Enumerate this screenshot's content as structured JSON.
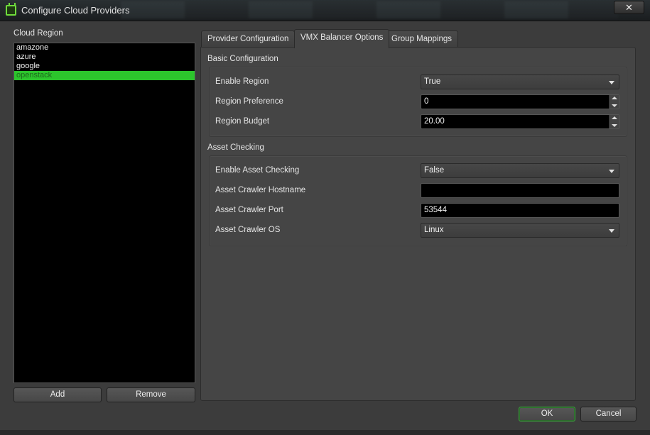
{
  "window": {
    "title": "Configure Cloud Providers",
    "close_label": "✕"
  },
  "left": {
    "label": "Cloud Region",
    "regions": [
      "amazone",
      "azure",
      "google",
      "openstack"
    ],
    "selected": "openstack",
    "add_label": "Add",
    "remove_label": "Remove"
  },
  "tabs": [
    {
      "label": "Provider Configuration",
      "active": false
    },
    {
      "label": "VMX Balancer Options",
      "active": true
    },
    {
      "label": "Group Mappings",
      "active": false
    }
  ],
  "basic": {
    "title": "Basic Configuration",
    "enable_region": {
      "label": "Enable Region",
      "value": "True"
    },
    "region_preference": {
      "label": "Region Preference",
      "value": "0"
    },
    "region_budget": {
      "label": "Region Budget",
      "value": "20.00"
    }
  },
  "asset": {
    "title": "Asset Checking",
    "enable_asset_checking": {
      "label": "Enable Asset Checking",
      "value": "False"
    },
    "crawler_hostname": {
      "label": "Asset Crawler Hostname",
      "value": ""
    },
    "crawler_port": {
      "label": "Asset Crawler Port",
      "value": "53544"
    },
    "crawler_os": {
      "label": "Asset Crawler OS",
      "value": "Linux"
    }
  },
  "footer": {
    "ok_label": "OK",
    "cancel_label": "Cancel"
  },
  "colors": {
    "selection": "#2cc52c",
    "accent_icon": "#6fdc3c"
  }
}
